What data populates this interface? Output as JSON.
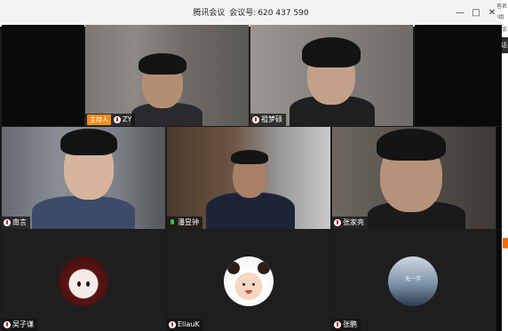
{
  "window": {
    "app_name": "腾讯会议",
    "meeting_id_label": "会议号:",
    "meeting_id": "620 437 590",
    "controls": {
      "minimize": "—",
      "maximize": "□",
      "close": "✕"
    }
  },
  "side_panel": {
    "speaking_label": "正在讲话:",
    "partial_labels": [
      "答名",
      "!组",
      "多余"
    ]
  },
  "host_badge": "主持人",
  "colors": {
    "host_badge": "#f08c1e",
    "mic_muted": "#d02020",
    "mic_active": "#35c24a",
    "background": "#1b1b1b"
  },
  "participants": [
    {
      "name": "ZY",
      "host": true,
      "mic": "muted",
      "video": "camera"
    },
    {
      "name": "祖梦硕",
      "host": false,
      "mic": "muted",
      "video": "camera"
    },
    {
      "name": "南言",
      "host": false,
      "mic": "muted",
      "video": "camera"
    },
    {
      "name": "潘昱钟",
      "host": false,
      "mic": "active",
      "video": "camera"
    },
    {
      "name": "张家亮",
      "host": false,
      "mic": "muted",
      "video": "camera"
    },
    {
      "name": "吴子谦",
      "host": false,
      "mic": "muted",
      "video": "avatar",
      "avatar_icon": "ghost-avatar-icon"
    },
    {
      "name": "EliauK",
      "host": false,
      "mic": "muted",
      "video": "avatar",
      "avatar_icon": "girl-avatar-icon"
    },
    {
      "name": "张鹏",
      "host": false,
      "mic": "muted",
      "video": "avatar",
      "avatar_icon": "sky-avatar-icon",
      "avatar_text": "无一字"
    }
  ]
}
